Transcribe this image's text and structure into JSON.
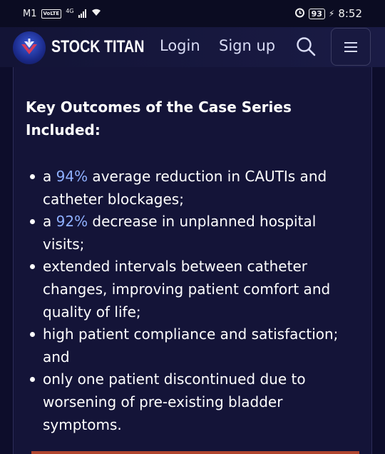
{
  "status_bar": {
    "carrier": "M1",
    "volte": "VoLTE",
    "network": "4G",
    "battery": "93",
    "time": "8:52"
  },
  "header": {
    "brand": "STOCK TITAN",
    "login": "Login",
    "signup": "Sign up",
    "accent": "#3a5bd9"
  },
  "article": {
    "section_title": "Key Outcomes of the Case Series Included:",
    "bullets": [
      {
        "prefix": "a ",
        "highlight": "94%",
        "text": " average reduction in CAUTIs and catheter blockages;"
      },
      {
        "prefix": "a ",
        "highlight": "92%",
        "text": " decrease in unplanned hospital visits;"
      },
      {
        "prefix": "",
        "highlight": "",
        "text": "extended intervals between catheter changes, improving patient comfort and quality of life;"
      },
      {
        "prefix": "",
        "highlight": "",
        "text": "high patient compliance and satisfaction; and"
      },
      {
        "prefix": "",
        "highlight": "",
        "text": "only one patient discontinued due to worsening of pre-existing bladder symptoms."
      }
    ]
  }
}
